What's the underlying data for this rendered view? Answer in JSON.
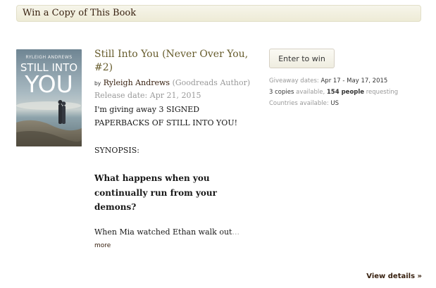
{
  "section": {
    "heading": "Win a Copy of This Book"
  },
  "book": {
    "cover": {
      "author_text": "RYLEIGH ANDREWS",
      "title_line1": "STILL INTO",
      "title_line2": "YOU"
    },
    "title": "Still Into You (Never Over You, #2)",
    "by": "by",
    "author": "Ryleigh Andrews",
    "author_role": "(Goodreads Author)",
    "release_date": "Release date: Apr 21, 2015",
    "description": [
      "I'm giving away 3 SIGNED",
      "PAPERBACKS OF STILL INTO YOU!",
      "SYNOPSIS:"
    ],
    "synopsis_heading": "What happens when you continually run from your demons?",
    "excerpt": "When Mia watched Ethan walk out",
    "excerpt_ellipsis": "...",
    "more_label": "more"
  },
  "giveaway": {
    "enter_label": "Enter to win",
    "dates_label": "Giveaway dates:",
    "dates_value": "Apr 17 - May 17, 2015",
    "copies_count": "3 copies",
    "copies_word": "available,",
    "people_count": "154 people",
    "people_word": "requesting",
    "countries_label": "Countries available:",
    "countries_value": "US"
  },
  "footer": {
    "view_details": "View details »"
  },
  "colors": {
    "link_brown": "#382110",
    "title_olive": "#665b2b",
    "muted_gray": "#999999",
    "header_bg": "#eeebd6"
  }
}
